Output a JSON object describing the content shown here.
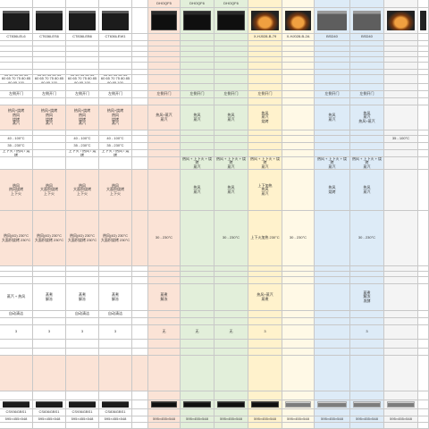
{
  "table": {
    "column_colors": [
      "#ffffff",
      "#ffffff",
      "#ffffff",
      "#ffffff",
      "#ffffff",
      "#fbe3d6",
      "#e2efda",
      "#e2efda",
      "#fff2cc",
      "#fff9e6",
      "#ddebf7",
      "#ddebf7",
      "#f4f4f4",
      "#ffffff"
    ],
    "highlight_color": "#fbe3d6",
    "rows": [
      {
        "cells": [
          "",
          "",
          "",
          "",
          "",
          "DHOQF5",
          "DHOQF6",
          "DHOQF6",
          "",
          "",
          "",
          "",
          "",
          ""
        ]
      },
      {
        "images": [
          "oven-dark",
          "oven-dark",
          "oven-dark",
          "oven-dark",
          "",
          "oven-black",
          "oven-black",
          "oven-black",
          "oven-lit",
          "oven-lit",
          "oven-gray",
          "oven-gray",
          "oven-lit",
          "oven-partial"
        ]
      },
      {
        "cells": [
          "CT836LEL6",
          "CT636LES6",
          "CT836LEB6",
          "CT636LEW1",
          "",
          "",
          "",
          "",
          "X-HJ028-B-79",
          "X-HJ028-B-2A",
          "BSD40",
          "BSD40",
          "",
          ""
        ]
      },
      {
        "cells": []
      },
      {
        "cells": []
      },
      {
        "cells": []
      },
      {
        "cells": []
      },
      {
        "cells": []
      },
      {
        "cells": []
      },
      {
        "cells": [
          "35 40 45 50 55\n60 65 70 75 80 85 90 95 100",
          "35 40 45 50 55\n60 65 70 75 80 85 90 95 100",
          "35 40 45 50 55\n60 65 70 75 80 85 90 95 100",
          "35 40 45 50 55\n60 65 70 75 80 85 90 95 100"
        ]
      },
      {
        "cells": []
      },
      {
        "cells": [
          "左侧开门",
          "左侧开门",
          "左侧开门",
          "左侧开门",
          "",
          "左侧开门",
          "左侧开门",
          "左侧开门",
          "左侧开门",
          "",
          "左侧开门",
          "左侧开门",
          "",
          ""
        ]
      },
      {
        "cells": []
      },
      {
        "highlight": true,
        "cells": [
          "热风+烧烤\n热风\n烧烤\n蒸汽",
          "热风+烧烤\n热风\n烧烤\n蒸汽",
          "热风+烧烤\n热风\n烧烤\n蒸汽",
          "热风+烧烤\n热风\n烧烤\n蒸汽",
          "",
          "热风+蒸汽\n蒸汽",
          "热风\n蒸汽",
          "热风\n蒸汽",
          "热风\n蒸汽\n烧烤",
          "",
          "热风\n蒸汽",
          "热风\n蒸汽\n热风+蒸汽",
          "",
          ""
        ]
      },
      {
        "cells": []
      },
      {
        "cells": [
          "40 - 100°C",
          "",
          "40 - 100°C",
          "40 - 100°C",
          "",
          "",
          "",
          "",
          "",
          "",
          "",
          "",
          "35 - 100°C",
          ""
        ]
      },
      {
        "cells": [
          "35 - 230°C",
          "",
          "35 - 230°C",
          "35 - 230°C"
        ]
      },
      {
        "cells": [
          "上下火 / 热风 / 烧烤",
          "",
          "上下火 / 热风 / 烧烤",
          "上下火 / 热风 / 烧烤"
        ]
      },
      {
        "cells": [
          "",
          "",
          "",
          "",
          "",
          "",
          "热风 + 上下火 + 烧烤\n蒸汽",
          "热风 + 上下火 + 烧烤\n蒸汽",
          "热风 + 上下火 + 烧烤\n蒸汽",
          "",
          "热风 + 上下火 + 烧烤\n蒸汽",
          "热风 + 上下火 + 烧烤\n蒸汽",
          "",
          ""
        ]
      },
      {
        "highlight": true,
        "cells": [
          "热风\n热风烧烤\n上下火",
          "热风\n大面积烧烤\n上下火",
          "热风\n大面积烧烤\n上下火",
          "热风\n大面积烧烤\n上下火",
          "",
          "",
          "热风\n蒸汽",
          "热风\n蒸汽",
          "上下加热\n热风\n蒸汽",
          "",
          "热风\n烧烤",
          "热风\n蒸汽",
          "",
          ""
        ]
      },
      {
        "highlight": true,
        "cells": [
          "热风(4D) 230°C\n大面积烧烤 230°C",
          "热风(4D) 230°C\n大面积烧烤 230°C",
          "热风(4D) 230°C\n大面积烧烤 230°C",
          "热风(4D) 230°C\n大面积烧烤 230°C",
          "",
          "30 - 230°C",
          "",
          "30 - 230°C",
          "上下火加热 230°C",
          "30 - 230°C",
          "",
          "30 - 230°C",
          "",
          ""
        ]
      },
      {
        "cells": []
      },
      {
        "cells": []
      },
      {
        "cells": []
      },
      {
        "cells": [
          "蒸汽 + 热风",
          "蒸煮\n解冻",
          "蒸煮\n解冻",
          "蒸煮\n解冻",
          "",
          "蒸煮\n解冻",
          "",
          "",
          "热风+蒸汽\n蒸煮",
          "",
          "",
          "蒸煮\n解冻\n发酵",
          "",
          ""
        ]
      },
      {
        "cells": [
          "自动清洁",
          "",
          "自动清洁",
          "自动清洁"
        ]
      },
      {
        "cells": []
      },
      {
        "cells": [
          "3",
          "3",
          "3",
          "3",
          "",
          "无",
          "无",
          "无",
          "3",
          "",
          "",
          "3",
          "",
          ""
        ]
      },
      {
        "cells": []
      },
      {
        "cells": []
      },
      {
        "highlight": true,
        "cells": []
      },
      {
        "cells": []
      },
      {
        "images": [
          "oven-dark",
          "oven-dark",
          "oven-dark",
          "oven-dark",
          "",
          "oven-black",
          "oven-black",
          "oven-black",
          "oven-black",
          "oven-steel",
          "oven-steel",
          "oven-steel",
          "oven-steel",
          ""
        ]
      },
      {
        "cells": [
          "CS936GBS1",
          "CS836GBS1",
          "CS936GBS1",
          "CS836GBS1",
          "",
          "",
          "",
          "",
          "",
          "",
          "",
          "",
          "",
          ""
        ]
      },
      {
        "cells": [
          "595×455×548",
          "595×455×548",
          "595×455×548",
          "595×455×548",
          "",
          "595×455×548",
          "595×455×548",
          "595×455×548",
          "595×455×548",
          "595×455×548",
          "595×455×548",
          "595×455×548",
          "595×455×548",
          ""
        ]
      },
      {
        "cells": []
      }
    ]
  }
}
